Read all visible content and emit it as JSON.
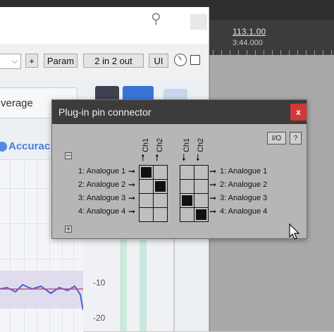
{
  "ruler": {
    "time_primary": "113.1.00",
    "time_secondary": "3:44.000"
  },
  "fx_window": {
    "toolbar": {
      "dropdown_value": "",
      "plus_label": "+",
      "param_label": "Param",
      "io_mode_label": "2 in 2 out",
      "ui_label": "UI"
    },
    "plugin": {
      "average_text": "verage",
      "accuracy_label": "Accurac"
    },
    "meter_labels": [
      "-10",
      "-20"
    ]
  },
  "pin_connector": {
    "title": "Plug-in pin connector",
    "close_label": "x",
    "io_button_label": "I/O",
    "help_button_label": "?",
    "collapse_label": "−",
    "expand_label": "+",
    "input_channels": [
      "Ch1",
      "Ch2"
    ],
    "output_channels": [
      "Ch1",
      "Ch2"
    ],
    "input_pins": [
      "1: Analogue 1",
      "2: Analogue 2",
      "3: Analogue 3",
      "4: Analogue 4"
    ],
    "output_pins": [
      "1: Analogue 1",
      "2: Analogue 2",
      "3: Analogue 3",
      "4: Analogue 4"
    ],
    "input_matrix": [
      [
        true,
        false
      ],
      [
        false,
        true
      ],
      [
        false,
        false
      ],
      [
        false,
        false
      ]
    ],
    "output_matrix": [
      [
        false,
        false
      ],
      [
        false,
        false
      ],
      [
        true,
        false
      ],
      [
        false,
        true
      ]
    ]
  },
  "colors": {
    "dialog_bg": "#b6b6b6",
    "titlebar": "#3c3c3c",
    "close_red": "#cf3838",
    "accent_blue": "#3a73d6"
  }
}
